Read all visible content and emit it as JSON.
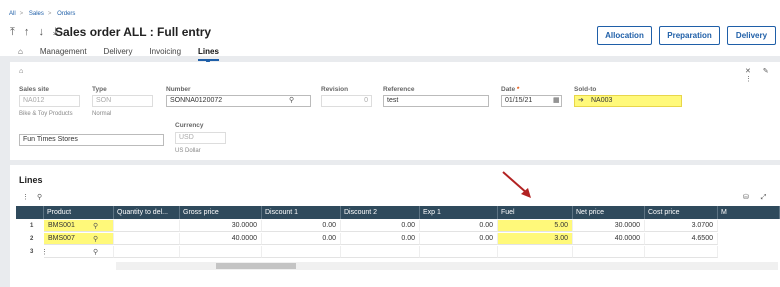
{
  "breadcrumb": {
    "items": [
      "All",
      "Sales",
      "Orders"
    ]
  },
  "toolbar": {
    "arrows": "⤒ ↑ ↓ ⤓",
    "title": "Sales order ALL : Full entry",
    "buttons": [
      "Allocation",
      "Preparation",
      "Delivery"
    ]
  },
  "tabs": [
    "Management",
    "Delivery",
    "Invoicing",
    "Lines"
  ],
  "header": {
    "sales_site": {
      "label": "Sales site",
      "value": "NA012",
      "sub": "Bike & Toy Products"
    },
    "type": {
      "label": "Type",
      "value": "SON",
      "sub": "Normal"
    },
    "number": {
      "label": "Number",
      "value": "SONNA0120072"
    },
    "revision": {
      "label": "Revision",
      "value": "0"
    },
    "reference": {
      "label": "Reference",
      "value": "test"
    },
    "date": {
      "label": "Date",
      "value": "01/15/21"
    },
    "sold_to": {
      "label": "Sold-to",
      "value": "NA003"
    },
    "customer_name": {
      "value": "Fun Times Stores"
    },
    "currency": {
      "label": "Currency",
      "value": "USD",
      "sub": "US Dollar"
    }
  },
  "lines": {
    "title": "Lines",
    "columns": [
      "Product",
      "Quantity to del...",
      "Gross price",
      "Discount 1",
      "Discount 2",
      "Exp 1",
      "Fuel",
      "Net price",
      "Cost price",
      "M"
    ],
    "rows": [
      {
        "n": "1",
        "product": "BMS001",
        "qty": "",
        "gross": "30.0000",
        "d1": "0.00",
        "d2": "0.00",
        "exp1": "0.00",
        "fuel": "5.00",
        "net": "30.0000",
        "cost": "3.0700"
      },
      {
        "n": "2",
        "product": "BMS007",
        "qty": "",
        "gross": "40.0000",
        "d1": "0.00",
        "d2": "0.00",
        "exp1": "0.00",
        "fuel": "3.00",
        "net": "40.0000",
        "cost": "4.6500"
      },
      {
        "n": "3",
        "product": "",
        "qty": "",
        "gross": "",
        "d1": "",
        "d2": "",
        "exp1": "",
        "fuel": "",
        "net": "",
        "cost": ""
      }
    ]
  },
  "colors": {
    "accent": "#1f5fa8",
    "highlight": "#fff97a",
    "grid_header": "#2f4a5c",
    "annotation_arrow": "#b22222"
  }
}
